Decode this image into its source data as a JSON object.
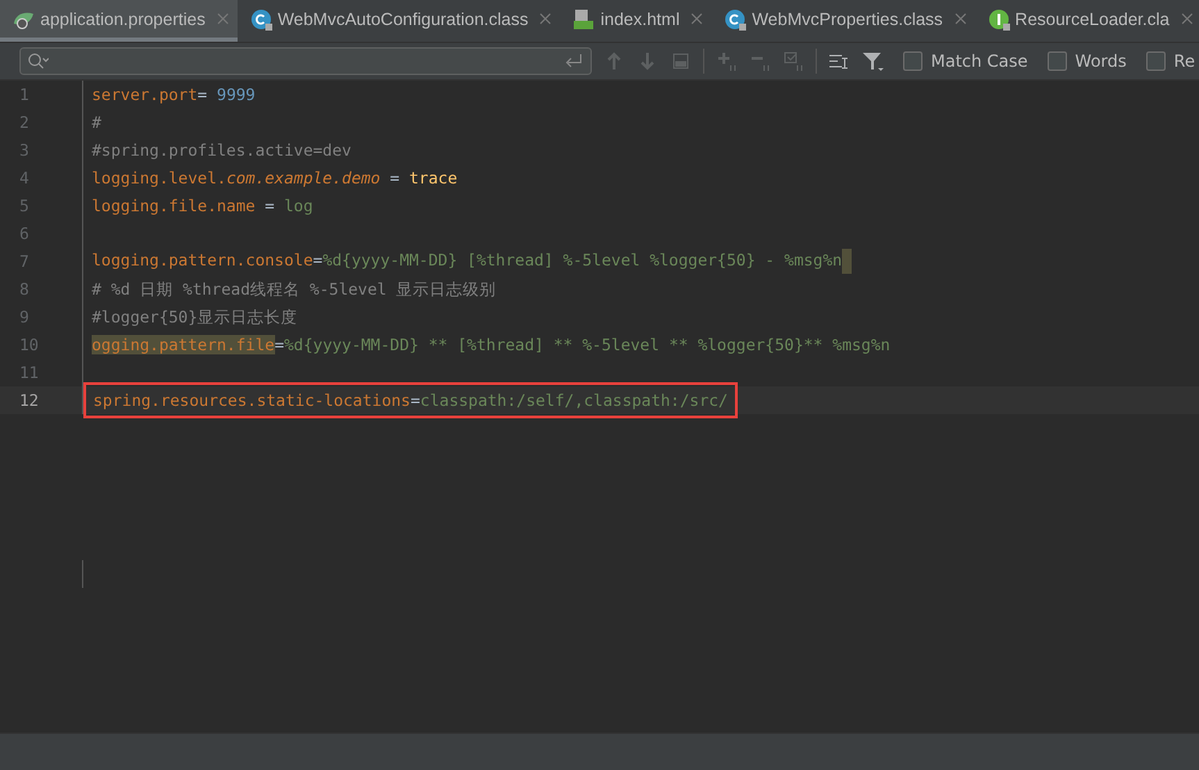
{
  "tabs": [
    {
      "label": "application.properties",
      "kind": "spring",
      "selected": true
    },
    {
      "label": "WebMvcAutoConfiguration.class",
      "kind": "class",
      "selected": false
    },
    {
      "label": "index.html",
      "kind": "html",
      "selected": false
    },
    {
      "label": "WebMvcProperties.class",
      "kind": "class",
      "selected": false
    },
    {
      "label": "ResourceLoader.cla",
      "kind": "interface",
      "selected": false
    }
  ],
  "search": {
    "options": [
      {
        "label": "Match Case",
        "checked": false
      },
      {
        "label": "Words",
        "checked": false
      },
      {
        "label": "Re",
        "checked": false
      }
    ]
  },
  "lines": [
    {
      "number": "1",
      "current": false,
      "segments": [
        {
          "kind": "key",
          "text": "server.port"
        },
        {
          "kind": "eq",
          "text": "= "
        },
        {
          "kind": "num",
          "text": "9999"
        }
      ]
    },
    {
      "number": "2",
      "current": false,
      "segments": [
        {
          "kind": "comment",
          "text": "#"
        }
      ]
    },
    {
      "number": "3",
      "current": false,
      "segments": [
        {
          "kind": "comment",
          "text": "#spring.profiles.active=dev"
        }
      ]
    },
    {
      "number": "4",
      "current": false,
      "segments": [
        {
          "kind": "key",
          "text": "logging.level."
        },
        {
          "kind": "italic",
          "text": "com.example.demo"
        },
        {
          "kind": "eq",
          "text": " = "
        },
        {
          "kind": "keyword",
          "text": "trace"
        }
      ]
    },
    {
      "number": "5",
      "current": false,
      "segments": [
        {
          "kind": "key",
          "text": "logging.file.name"
        },
        {
          "kind": "eq",
          "text": " = "
        },
        {
          "kind": "value",
          "text": "log"
        }
      ]
    },
    {
      "number": "6",
      "current": false
    },
    {
      "number": "7",
      "current": false,
      "caret_block": true,
      "segments": [
        {
          "kind": "key",
          "text": "logging.pattern.console"
        },
        {
          "kind": "eq",
          "text": "="
        },
        {
          "kind": "value",
          "text": "%d{yyyy-MM-DD} [%thread] %-5level %logger{50} - %msg%n"
        }
      ]
    },
    {
      "number": "8",
      "current": false,
      "segments": [
        {
          "kind": "comment",
          "text": "# %d 日期 %thread线程名 %-5level 显示日志级别"
        }
      ]
    },
    {
      "number": "9",
      "current": false,
      "segments": [
        {
          "kind": "comment",
          "text": "#logger{50}显示日志长度"
        }
      ]
    },
    {
      "number": "10",
      "current": false,
      "segments": [
        {
          "kind": "key",
          "text": "ogging.pattern.file",
          "highlighted": true
        },
        {
          "kind": "eq",
          "text": "="
        },
        {
          "kind": "value",
          "text": "%d{yyyy-MM-DD} ** [%thread] ** %-5level ** %logger{50}** %msg%n"
        }
      ]
    },
    {
      "number": "11",
      "current": false
    },
    {
      "number": "12",
      "current": true,
      "boxed": true,
      "segments": [
        {
          "kind": "key",
          "text": "spring.resources.static-locations"
        },
        {
          "kind": "eq",
          "text": "="
        },
        {
          "kind": "value",
          "text": "classpath:/self/,classpath:/src/"
        }
      ]
    }
  ]
}
